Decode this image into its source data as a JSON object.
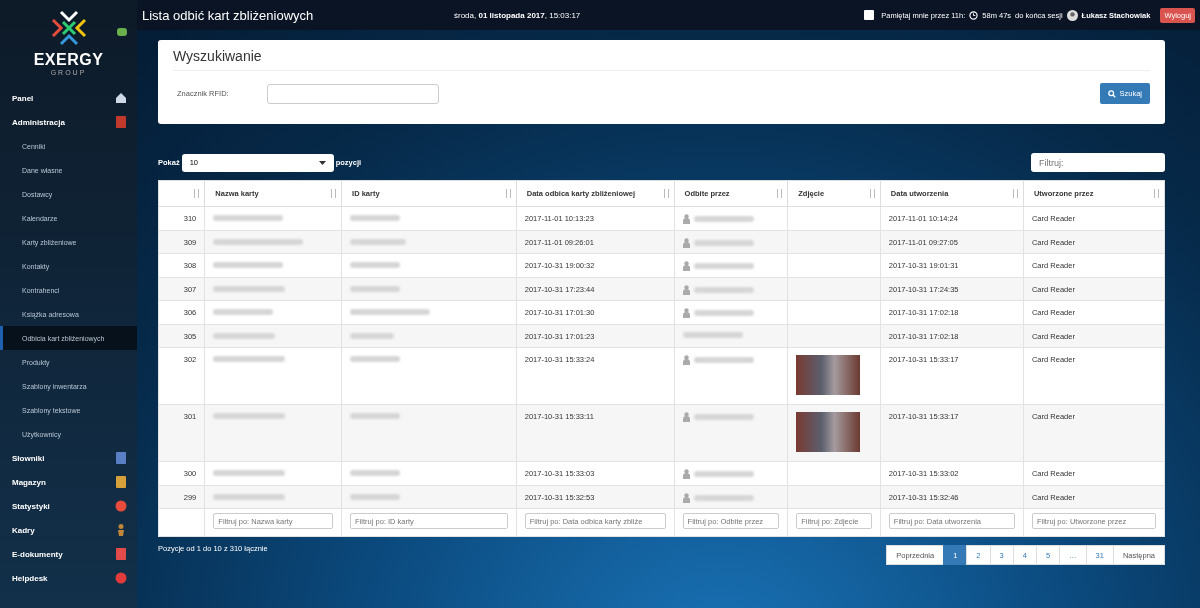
{
  "logo": {
    "name": "EXERGY",
    "sub": "GROUP"
  },
  "sidebar": {
    "items": [
      {
        "label": "Panel",
        "kind": "section",
        "selected": false
      },
      {
        "label": "Administracja",
        "kind": "section",
        "selected": false,
        "children": [
          {
            "label": "Cenniki",
            "selected": false
          },
          {
            "label": "Dane własne",
            "selected": false
          },
          {
            "label": "Dostawcy",
            "selected": false
          },
          {
            "label": "Kalendarze",
            "selected": false
          },
          {
            "label": "Karty zbliżeniowe",
            "selected": false
          },
          {
            "label": "Kontakty",
            "selected": false
          },
          {
            "label": "Kontrahenci",
            "selected": false
          },
          {
            "label": "Książka adresowa",
            "selected": false
          },
          {
            "label": "Odbicia kart zbliżeniowych",
            "selected": true
          },
          {
            "label": "Produkty",
            "selected": false
          },
          {
            "label": "Szablony inwentarza",
            "selected": false
          },
          {
            "label": "Szablony tekstowe",
            "selected": false
          },
          {
            "label": "Użytkownicy",
            "selected": false
          }
        ]
      },
      {
        "label": "Słowniki",
        "kind": "section",
        "selected": false
      },
      {
        "label": "Magazyn",
        "kind": "section",
        "selected": false
      },
      {
        "label": "Statystyki",
        "kind": "section",
        "selected": false
      },
      {
        "label": "Kadry",
        "kind": "section",
        "selected": false
      },
      {
        "label": "E-dokumenty",
        "kind": "section",
        "selected": false
      },
      {
        "label": "Helpdesk",
        "kind": "section",
        "selected": false
      }
    ]
  },
  "header": {
    "title": "Lista odbić kart zbliżeniowych",
    "date_prefix": "środa, ",
    "date": "01 listopada 2017",
    "time": ", 15:03:17",
    "remember_checked": false,
    "remember_label": "Pamiętaj mnie przez 11h:",
    "session": "58m 47s",
    "session_suffix": "do końca sesji",
    "user": "Łukasz Stachowiak",
    "logout": "Wyloguj"
  },
  "search": {
    "title": "Wyszukiwanie",
    "field_label": "Znacznik RFID:",
    "button": "Szukaj"
  },
  "table_controls": {
    "show_label": "Pokaż",
    "page_size": "10",
    "show_suffix": "pozycji",
    "filter_placeholder": "Filtruj:"
  },
  "table": {
    "columns": [
      "",
      "Nazwa karty",
      "ID karty",
      "Data odbica karty zbliżeniowej",
      "Odbite przez",
      "Zdjęcie",
      "Data utworzenia",
      "Utworzone przez"
    ],
    "rows": [
      {
        "id": "310",
        "scanned": "2017-11-01 10:13:23",
        "avatar": true,
        "photo": false,
        "created": "2017-11-01 10:14:24",
        "created_by": "Card Reader"
      },
      {
        "id": "309",
        "scanned": "2017-11-01 09:26:01",
        "avatar": true,
        "photo": false,
        "created": "2017-11-01 09:27:05",
        "created_by": "Card Reader"
      },
      {
        "id": "308",
        "scanned": "2017-10-31 19:00:32",
        "avatar": true,
        "photo": false,
        "created": "2017-10-31 19:01:31",
        "created_by": "Card Reader"
      },
      {
        "id": "307",
        "scanned": "2017-10-31 17:23:44",
        "avatar": true,
        "photo": false,
        "created": "2017-10-31 17:24:35",
        "created_by": "Card Reader"
      },
      {
        "id": "306",
        "scanned": "2017-10-31 17:01:30",
        "avatar": true,
        "photo": false,
        "created": "2017-10-31 17:02:18",
        "created_by": "Card Reader"
      },
      {
        "id": "305",
        "scanned": "2017-10-31 17:01:23",
        "avatar": false,
        "photo": false,
        "created": "2017-10-31 17:02:18",
        "created_by": "Card Reader"
      },
      {
        "id": "302",
        "scanned": "2017-10-31 15:33:24",
        "avatar": true,
        "photo": true,
        "created": "2017-10-31 15:33:17",
        "created_by": "Card Reader"
      },
      {
        "id": "301",
        "scanned": "2017-10-31 15:33:11",
        "avatar": true,
        "photo": true,
        "created": "2017-10-31 15:33:17",
        "created_by": "Card Reader"
      },
      {
        "id": "300",
        "scanned": "2017-10-31 15:33:03",
        "avatar": true,
        "photo": false,
        "created": "2017-10-31 15:33:02",
        "created_by": "Card Reader"
      },
      {
        "id": "299",
        "scanned": "2017-10-31 15:32:53",
        "avatar": true,
        "photo": false,
        "created": "2017-10-31 15:32:46",
        "created_by": "Card Reader"
      }
    ],
    "column_filters": [
      {
        "placeholder": "Filtruj po: Nazwa karty"
      },
      {
        "placeholder": "Filtruj po: ID karty"
      },
      {
        "placeholder": "Filtruj po: Data odbica karty zbliże"
      },
      {
        "placeholder": "Filtruj po: Odbite przez"
      },
      {
        "placeholder": "Filtruj po: Zdjecie"
      },
      {
        "placeholder": "Filtruj po: Data utworzenia"
      },
      {
        "placeholder": "Filtruj po: Utworzone przez"
      }
    ]
  },
  "footer": {
    "info": "Pozycje od 1 do 10 z 310 łącznie",
    "pages": [
      {
        "label": "Poprzednia",
        "selected": false
      },
      {
        "label": "1",
        "selected": true
      },
      {
        "label": "2",
        "selected": false
      },
      {
        "label": "3",
        "selected": false
      },
      {
        "label": "4",
        "selected": false
      },
      {
        "label": "5",
        "selected": false
      },
      {
        "label": "…",
        "selected": false
      },
      {
        "label": "31",
        "selected": false
      },
      {
        "label": "Następna",
        "selected": false
      }
    ]
  }
}
